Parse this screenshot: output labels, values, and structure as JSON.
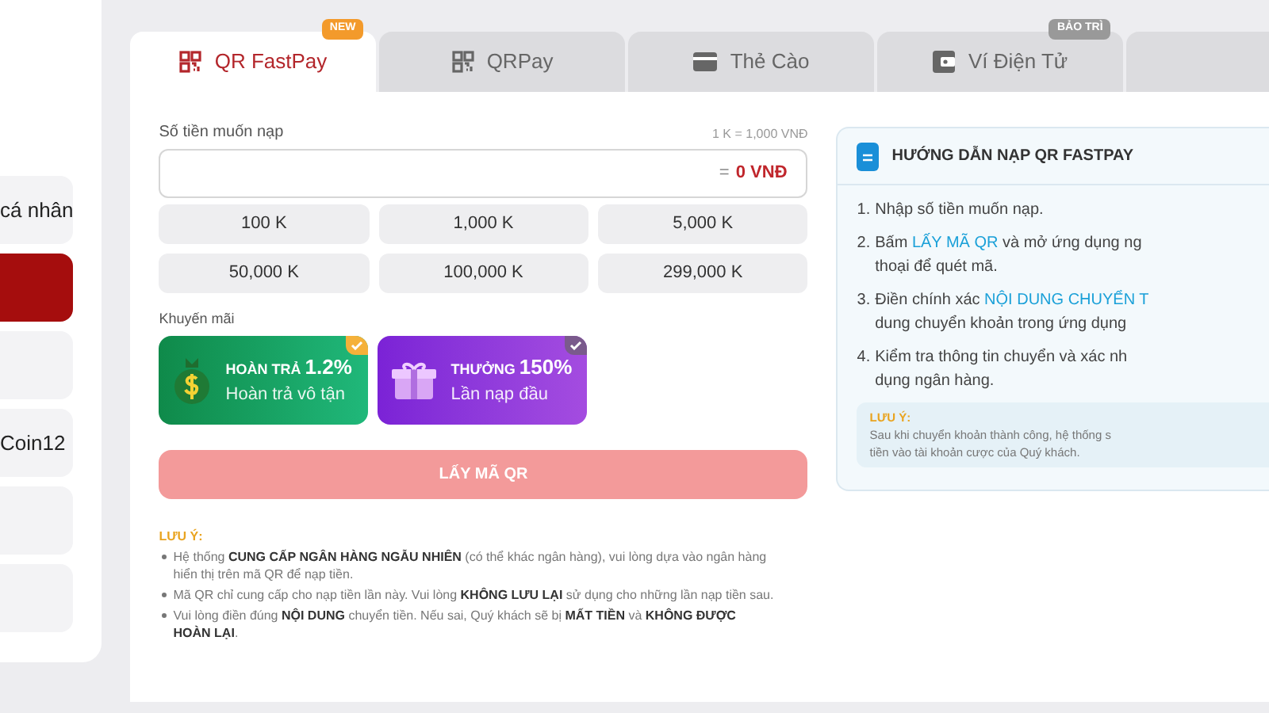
{
  "sidebar": {
    "items": [
      {
        "label": "cá nhân",
        "selected": false
      },
      {
        "selected": true
      },
      {
        "selected": false
      },
      {
        "label": "Coin12",
        "selected": false
      },
      {
        "selected": false
      },
      {
        "selected": false
      }
    ]
  },
  "tabs": [
    {
      "label": "QR FastPay",
      "kind": "qr",
      "selected": true,
      "badge": "NEW"
    },
    {
      "label": "QRPay",
      "kind": "qr",
      "selected": false
    },
    {
      "label": "Thẻ Cào",
      "kind": "card",
      "selected": false
    },
    {
      "label": "Ví Điện Tử",
      "kind": "wallet",
      "selected": false,
      "badge": "BẢO TRÌ"
    },
    {
      "kind": "blank",
      "selected": false
    }
  ],
  "amount": {
    "label": "Số tiền muốn nạp",
    "rate": "1 K = 1,000 VNĐ",
    "prefix": "=",
    "total": "0 VNĐ"
  },
  "presets": [
    "100 K",
    "1,000 K",
    "5,000 K",
    "50,000 K",
    "100,000 K",
    "299,000 K"
  ],
  "promo": {
    "label": "Khuyến mãi",
    "cards": [
      {
        "kind": "cashback",
        "title": "HOÀN TRẢ",
        "value": "1.2%",
        "subtitle": "Hoàn trả vô tận",
        "selected": true
      },
      {
        "kind": "bonus",
        "title": "THƯỞNG",
        "value": "150%",
        "subtitle": "Lần nạp đầu",
        "selected": false
      }
    ]
  },
  "submit": {
    "label": "LẤY MÃ QR",
    "disabled": true
  },
  "notes": {
    "title": "LƯU Ý:",
    "items": [
      "Hệ thống **CUNG CẤP NGÂN HÀNG NGẪU NHIÊN** (có thể khác ngân hàng), vui lòng dựa vào ngân hàng hiển thị trên mã QR để nạp tiền.",
      "Mã QR chỉ cung cấp cho nạp tiền lần này. Vui lòng **KHÔNG LƯU LẠI** sử dụng cho những lần nạp tiền sau.",
      "Vui lòng điền đúng **NỘI DUNG** chuyển tiền. Nếu sai, Quý khách sẽ bị **MẤT TIỀN** và **KHÔNG ĐƯỢC HOÀN LẠI**."
    ]
  },
  "guide": {
    "title": "HƯỚNG DẪN NẠP QR FASTPAY",
    "steps": [
      {
        "number": "1.",
        "lines": [
          [
            {
              "text": "Nhập số tiền muốn nạp.",
              "highlight": false
            }
          ]
        ]
      },
      {
        "number": "2.",
        "lines": [
          [
            {
              "text": "Bấm ",
              "highlight": false
            },
            {
              "text": "LẤY MÃ QR",
              "highlight": true
            },
            {
              "text": " và mở ứng dụng ng",
              "highlight": false
            }
          ],
          [
            {
              "text": "thoại để quét mã.",
              "highlight": false
            }
          ]
        ]
      },
      {
        "number": "3.",
        "lines": [
          [
            {
              "text": "Điền chính xác ",
              "highlight": false
            },
            {
              "text": "NỘI DUNG CHUYỂN T",
              "highlight": true
            }
          ],
          [
            {
              "text": "dung chuyển khoản trong ứng dụng",
              "highlight": false
            }
          ]
        ]
      },
      {
        "number": "4.",
        "lines": [
          [
            {
              "text": "Kiểm tra thông tin chuyển và xác nh",
              "highlight": false
            }
          ],
          [
            {
              "text": "dụng ngân hàng.",
              "highlight": false
            }
          ]
        ]
      }
    ],
    "note_title": "LƯU Ý:",
    "note_lines": [
      "Sau khi chuyển khoản thành công, hệ thống s",
      "tiền vào tài khoản cược của Quý khách."
    ]
  }
}
